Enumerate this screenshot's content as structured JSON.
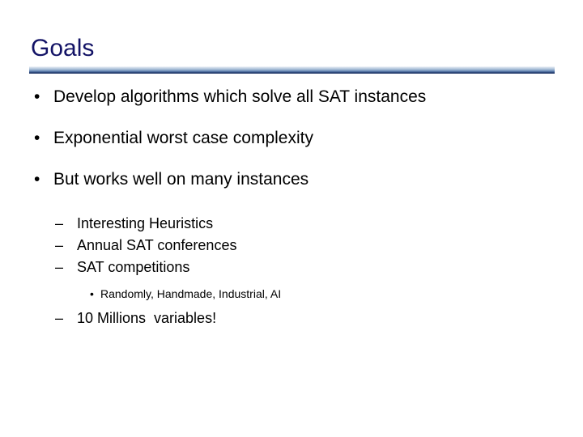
{
  "slide": {
    "title": "Goals",
    "title_color": "#131366",
    "background_color": "#ffffff",
    "text_color": "#000000",
    "rule_gradient_top": "#dce5f0",
    "rule_gradient_bottom": "#1b2f5e",
    "bullets": {
      "level1_marker": "•",
      "level2_marker": "–",
      "level3_marker": "•",
      "item1": "Develop algorithms which solve all SAT instances",
      "item2": "Exponential worst case complexity",
      "item3": "But works well on many instances",
      "sub1": "Interesting Heuristics",
      "sub2": "Annual SAT conferences",
      "sub3": "SAT competitions",
      "subsub1": "Randomly, Handmade, Industrial, AI",
      "sub4": "10 Millions  variables!"
    }
  }
}
